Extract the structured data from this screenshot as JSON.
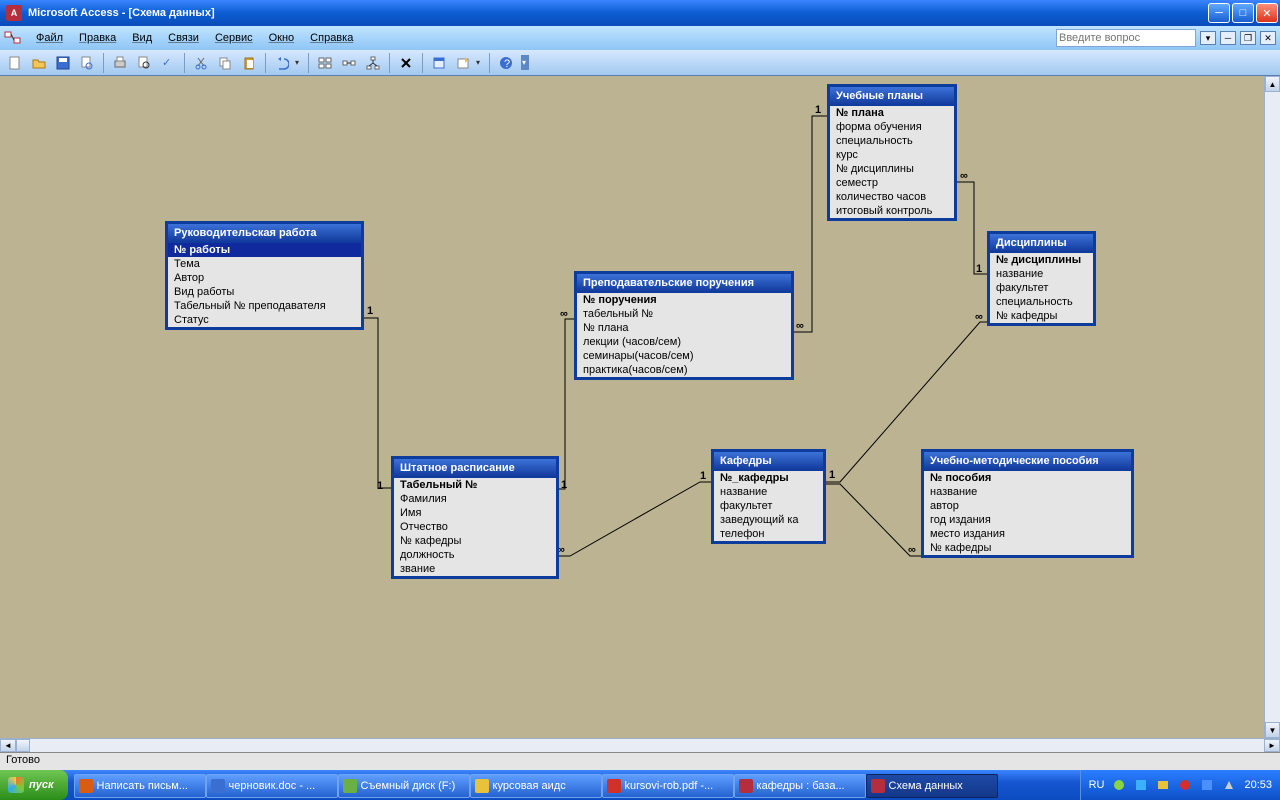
{
  "title": "Microsoft Access - [Схема данных]",
  "menus": [
    "Файл",
    "Правка",
    "Вид",
    "Связи",
    "Сервис",
    "Окно",
    "Справка"
  ],
  "question_placeholder": "Введите вопрос",
  "status": "Готово",
  "tables": {
    "t1": {
      "title": "Руководительская работа",
      "fields": [
        "№ работы",
        "Тема",
        "Автор",
        "Вид работы",
        "Табельный № преподавателя",
        "Статус"
      ],
      "pk": 0,
      "sel": 0
    },
    "t2": {
      "title": "Преподавательские поручения",
      "fields": [
        "№ поручения",
        "табельный №",
        "№ плана",
        "лекции (часов/сем)",
        "семинары(часов/сем)",
        "практика(часов/сем)"
      ],
      "pk": 0
    },
    "t3": {
      "title": "Учебные планы",
      "fields": [
        "№ плана",
        "форма обучения",
        "специальность",
        "курс",
        "№ дисциплины",
        "семестр",
        "количество часов",
        "итоговый контроль"
      ],
      "pk": 0
    },
    "t4": {
      "title": "Дисциплины",
      "fields": [
        "№ дисциплины",
        "название",
        "факультет",
        "специальность",
        "№ кафедры"
      ],
      "pk": 0
    },
    "t5": {
      "title": "Штатное расписание",
      "fields": [
        "Табельный №",
        "Фамилия",
        "Имя",
        "Отчество",
        "№ кафедры",
        "должность",
        "звание"
      ],
      "pk": 0
    },
    "t6": {
      "title": "Кафедры",
      "fields": [
        "№_кафедры",
        "название",
        "факультет",
        "заведующий ка",
        "телефон"
      ],
      "pk": 0
    },
    "t7": {
      "title": "Учебно-методические пособия",
      "fields": [
        "№ пособия",
        "название",
        "автор",
        "год издания",
        "место издания",
        "№  кафедры"
      ],
      "pk": 0
    }
  },
  "rel_labels": {
    "one": "1",
    "inf": "∞"
  },
  "taskbar": {
    "start": "пуск",
    "tasks": [
      {
        "icon": "#d95d10",
        "label": "Написать письм..."
      },
      {
        "icon": "#3a6ed0",
        "label": "черновик.doc - ..."
      },
      {
        "icon": "#6ab045",
        "label": "Съемный диск (F:)"
      },
      {
        "icon": "#e7c23a",
        "label": "курсовая аидс"
      },
      {
        "icon": "#d2302a",
        "label": "kursovi-rob.pdf -..."
      },
      {
        "icon": "#b42e3e",
        "label": "кафедры : база..."
      },
      {
        "icon": "#b42e3e",
        "label": "Схема данных",
        "active": true
      }
    ],
    "lang": "RU",
    "clock": "20:53"
  }
}
